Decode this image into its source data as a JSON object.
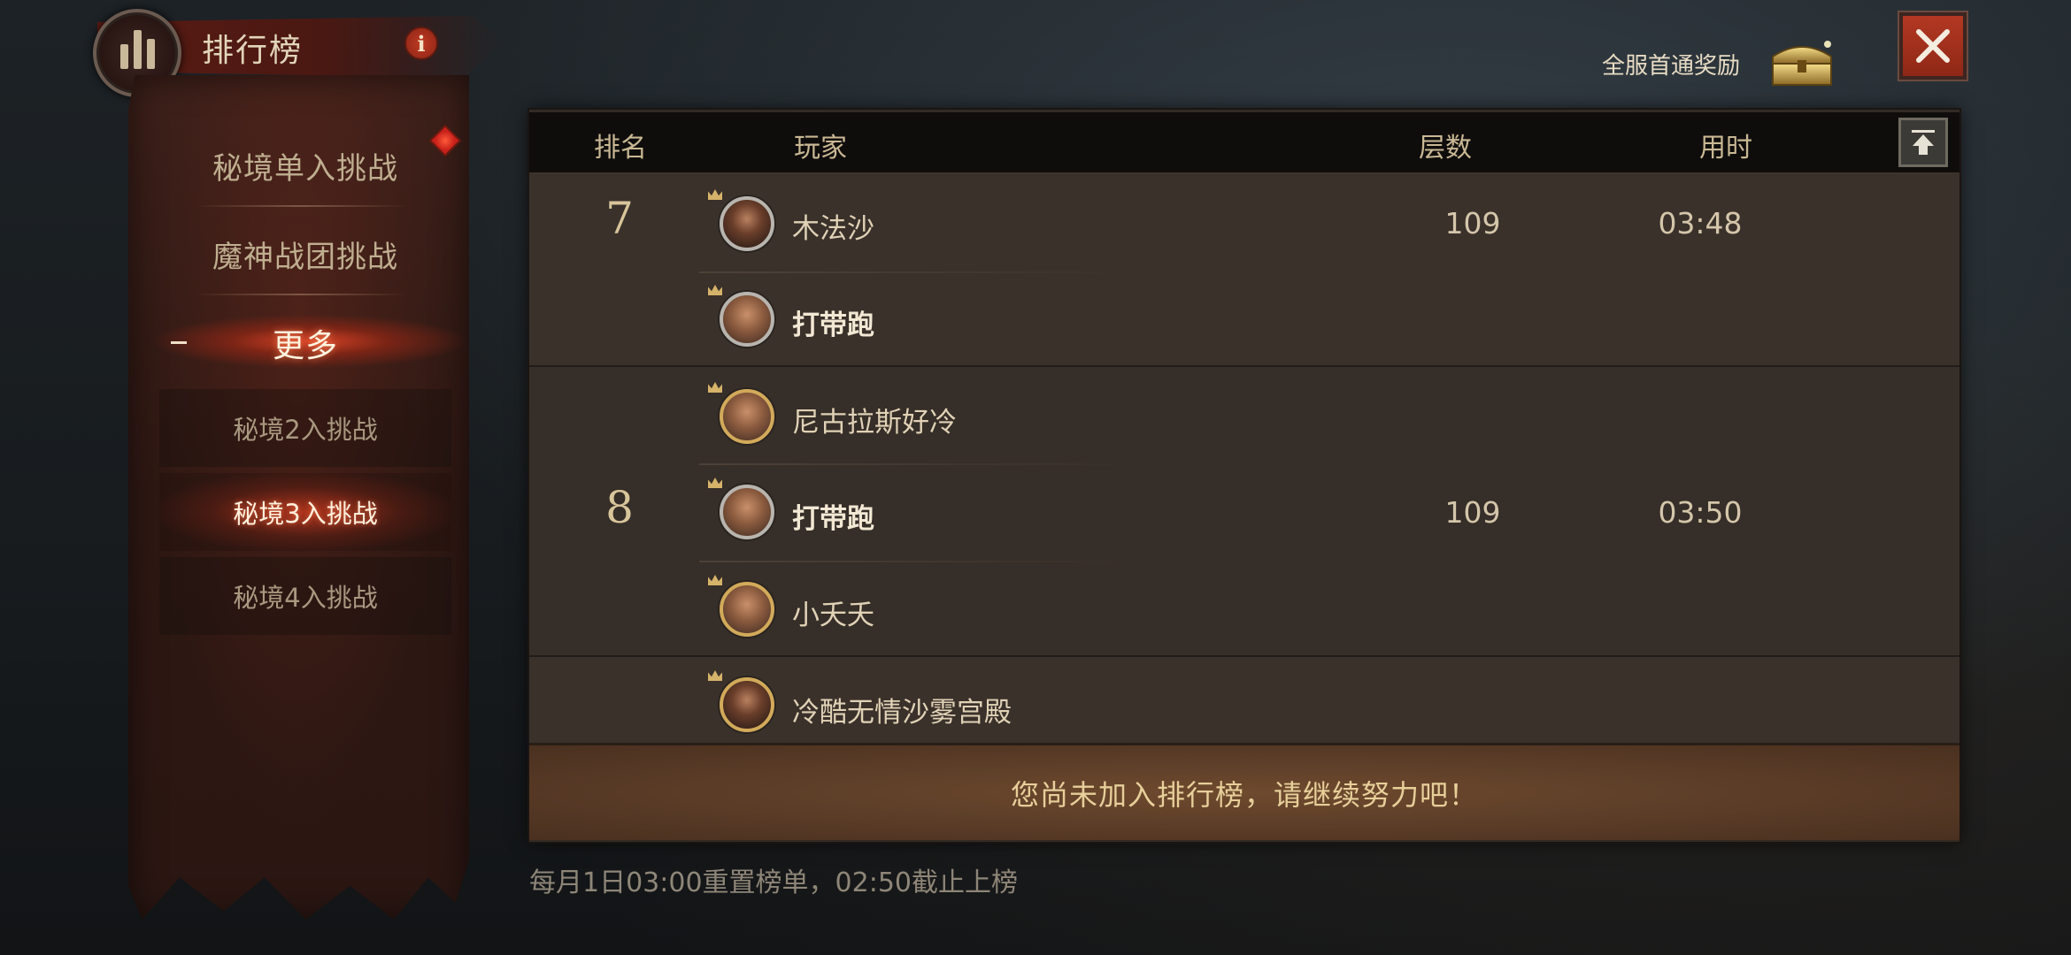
{
  "header": {
    "title": "排行榜",
    "info_icon": "info-icon",
    "reward_label": "全服首通奖励",
    "chest_icon": "treasure-chest-icon",
    "close_icon": "close-icon"
  },
  "sidebar": {
    "items": [
      {
        "label": "秘境单入挑战"
      },
      {
        "label": "魔神战团挑战"
      },
      {
        "label": "更多"
      }
    ],
    "sub_items": [
      {
        "label": "秘境2入挑战"
      },
      {
        "label": "秘境3入挑战",
        "active": true
      },
      {
        "label": "秘境4入挑战"
      }
    ]
  },
  "table": {
    "headers": {
      "rank": "排名",
      "player": "玩家",
      "floors": "层数",
      "time": "用时"
    },
    "groups": [
      {
        "rank": "7",
        "floors": "109",
        "time": "03:48",
        "players": [
          {
            "name": "木法沙",
            "bold": false
          },
          {
            "name": "打带跑",
            "bold": true
          }
        ]
      },
      {
        "rank": "8",
        "floors": "109",
        "time": "03:50",
        "players": [
          {
            "name": "尼古拉斯好冷",
            "bold": false
          },
          {
            "name": "打带跑",
            "bold": true
          },
          {
            "name": "小夭夭",
            "bold": false
          }
        ]
      },
      {
        "rank": "",
        "floors": "",
        "time": "",
        "players": [
          {
            "name": "冷酷无情沙雾宫殿",
            "bold": false
          }
        ]
      }
    ]
  },
  "footer": {
    "banner": "您尚未加入排行榜，请继续努力吧！",
    "reset_note": "每月1日03:00重置榜单，02:50截止上榜"
  },
  "colors": {
    "accent_red": "#b33823",
    "gold": "#d2aa5a",
    "panel": "#322a25"
  }
}
